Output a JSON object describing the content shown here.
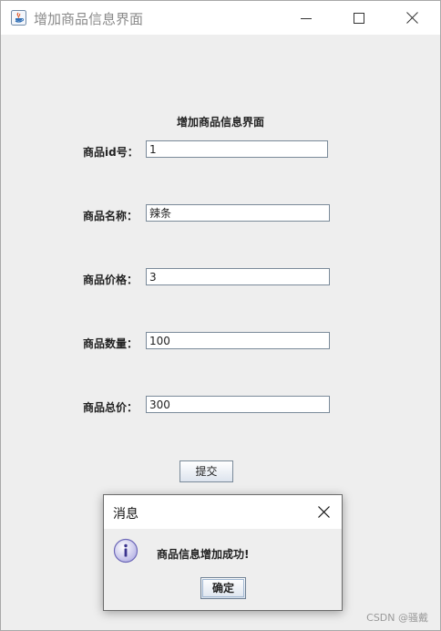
{
  "window": {
    "title": "增加商品信息界面",
    "controls": {
      "minimize": "minimize-icon",
      "maximize": "maximize-icon",
      "close": "close-icon"
    }
  },
  "form": {
    "heading": "增加商品信息界面",
    "fields": [
      {
        "label": "商品id号：",
        "value": "1"
      },
      {
        "label": "商品名称：",
        "value": "辣条"
      },
      {
        "label": "商品价格：",
        "value": "3"
      },
      {
        "label": "商品数量：",
        "value": "100"
      },
      {
        "label": "商品总价：",
        "value": "300"
      }
    ],
    "submit_label": "提交"
  },
  "dialog": {
    "title": "消息",
    "icon": "info-icon",
    "message": "商品信息增加成功!",
    "ok_label": "确定"
  },
  "watermark": "CSDN @骚戴",
  "colors": {
    "border": "#7a8a99",
    "background": "#eeeeee",
    "title_bar": "#ffffff"
  }
}
